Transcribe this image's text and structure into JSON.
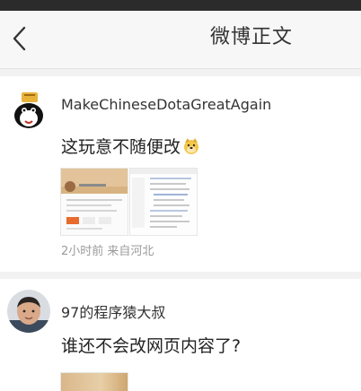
{
  "header": {
    "title": "微博正文",
    "back_icon": "chevron-left-icon"
  },
  "comments": [
    {
      "username": "MakeChineseDotaGreatAgain",
      "text": "这玩意不随便改",
      "emoji": "doge-emoji",
      "time": "2小时前",
      "source": "来自河北",
      "images": 2
    },
    {
      "username": "97的程序猿大叔",
      "text": "谁还不会改网页内容了?",
      "images": 1
    }
  ],
  "colors": {
    "status_bar": "#2b2b2b",
    "nav_bg": "#f7f7f7",
    "separator": "#f2f2f2",
    "meta_text": "#9a9a9a"
  }
}
